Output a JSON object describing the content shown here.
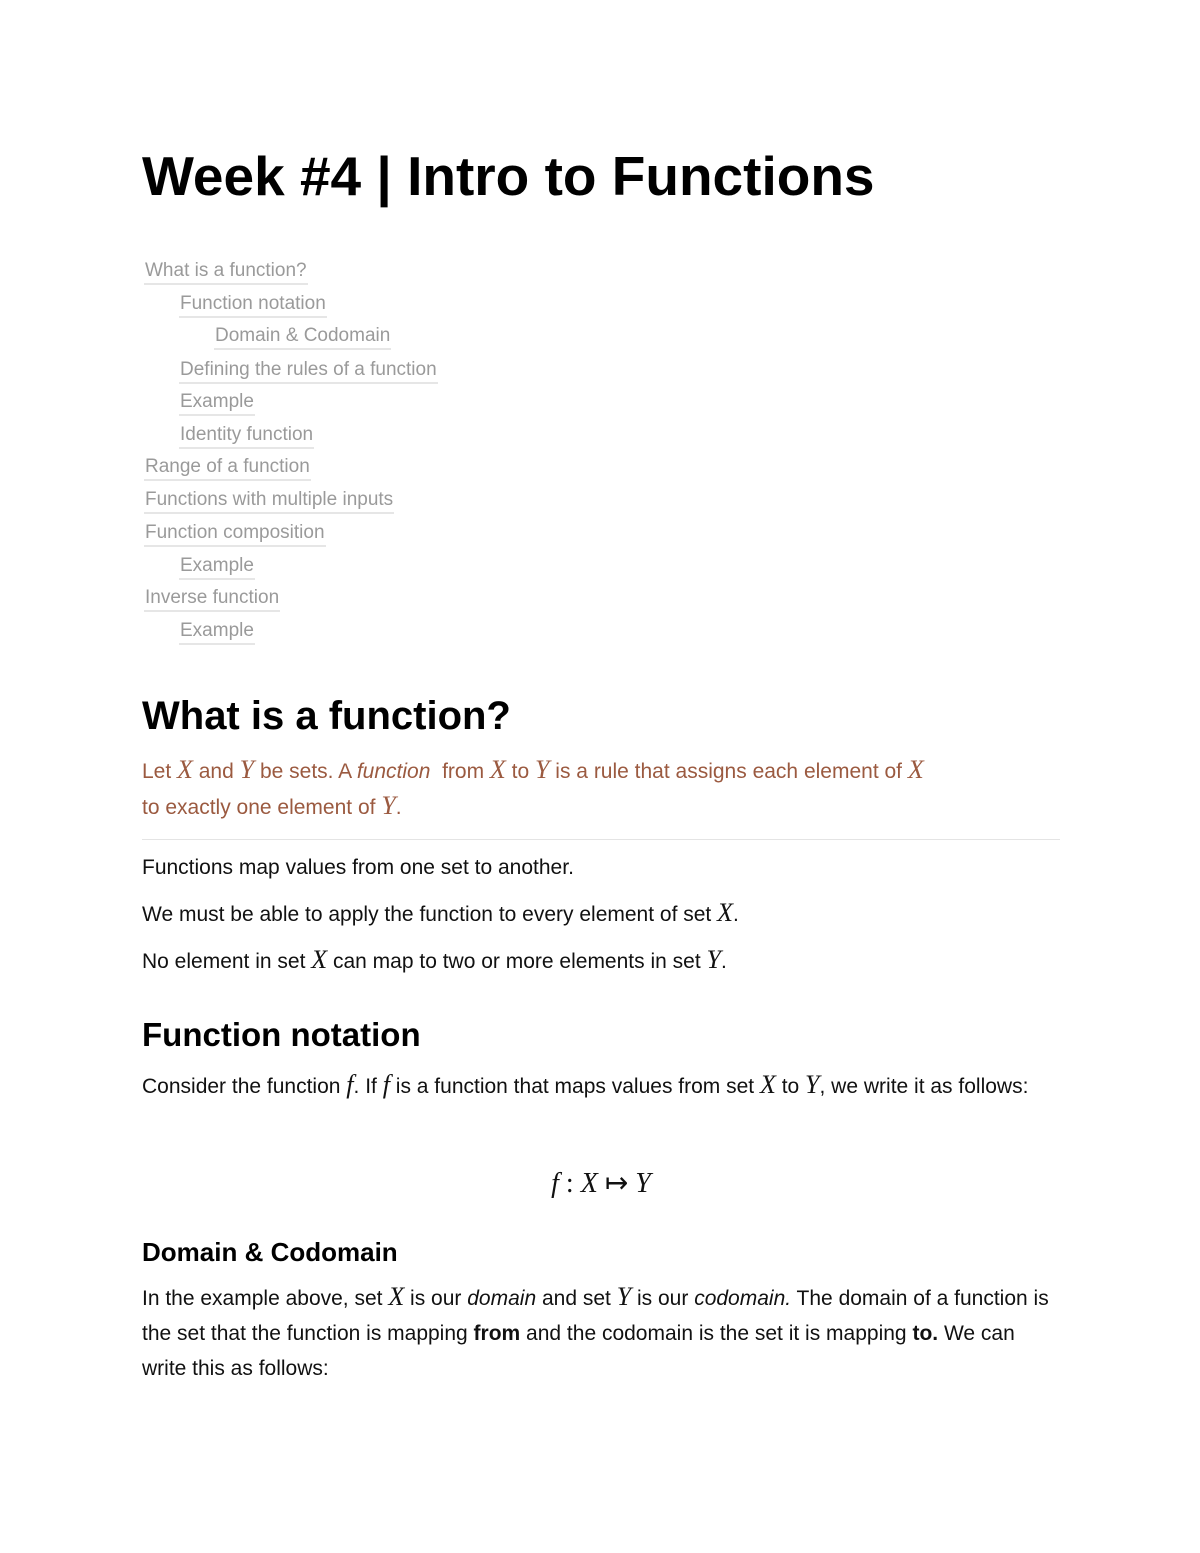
{
  "title": "Week #4 | Intro to Functions",
  "toc": [
    {
      "label": "What is a function?",
      "level": 0
    },
    {
      "label": "Function notation",
      "level": 1
    },
    {
      "label": "Domain & Codomain",
      "level": 2
    },
    {
      "label": "Defining the rules of a function",
      "level": 1
    },
    {
      "label": "Example",
      "level": 1
    },
    {
      "label": "Identity function",
      "level": 1
    },
    {
      "label": "Range of a function",
      "level": 0
    },
    {
      "label": "Functions with multiple inputs",
      "level": 0
    },
    {
      "label": "Function composition",
      "level": 0
    },
    {
      "label": "Example",
      "level": 1
    },
    {
      "label": "Inverse function",
      "level": 0
    },
    {
      "label": "Example",
      "level": 1
    }
  ],
  "colors": {
    "callout_text": "#9b5a40",
    "toc_link": "#9a9a9a"
  },
  "sections": {
    "what_is": {
      "heading": "What is a function?",
      "callout": {
        "t1": "Let ",
        "x1": "X",
        "t2": " and ",
        "y1": "Y",
        "t3": " be sets. A ",
        "em": "function",
        "t4": "  from ",
        "x2": "X",
        "t5": " to ",
        "y2": "Y",
        "t6": " is a rule that assigns each element of ",
        "x3": "X",
        "t7": " to exactly one element of ",
        "y3": "Y",
        "t8": "."
      },
      "p1": "Functions map values from one set to another.",
      "p2": {
        "t1": "We must be able to apply the function to every element of set ",
        "x": "X",
        "t2": "."
      },
      "p3": {
        "t1": "No element in set ",
        "x": "X",
        "t2": " can map to two or more elements in set ",
        "y": "Y",
        "t3": "."
      }
    },
    "notation": {
      "heading": "Function notation",
      "p": {
        "t1": "Consider the function ",
        "f1": "f",
        "t2": ". If ",
        "f2": "f",
        "t3": " is a function that maps values from set ",
        "x": "X",
        "t4": " to ",
        "y": "Y",
        "t5": ", we write it as follows:"
      },
      "equation": {
        "f": "f",
        "colon": " : ",
        "x": "X",
        "arrow": " ↦ ",
        "y": "Y"
      }
    },
    "domain": {
      "heading": "Domain & Codomain",
      "p": {
        "t1": "In the example above, set ",
        "x": "X",
        "t2": " is our ",
        "em1": "domain",
        "t3": " and set ",
        "y": "Y",
        "t4": " is our ",
        "em2": "codomain.",
        "t5": " The domain of a function is the set that the function is mapping ",
        "b1": "from",
        "t6": " and the codomain is the set it is mapping ",
        "b2": "to.",
        "t7": " We can write this as follows:"
      }
    }
  }
}
